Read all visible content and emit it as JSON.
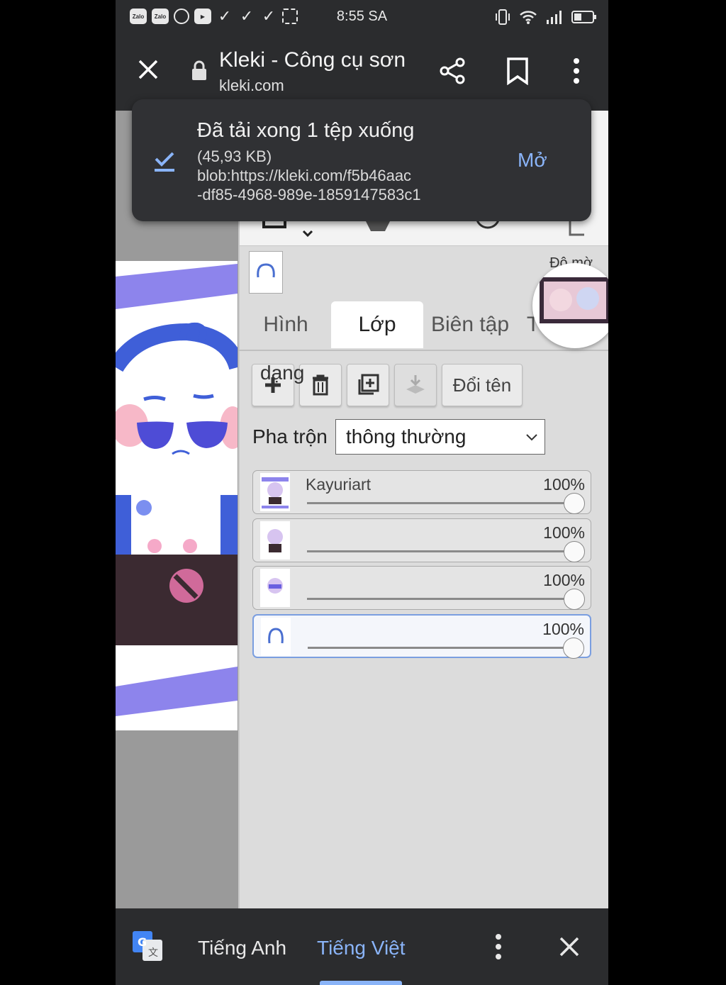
{
  "status_bar": {
    "time": "8:55 SA",
    "app_icons": [
      "Zalo",
      "Zalo"
    ]
  },
  "browser": {
    "title": "Kleki - Công cụ sơn",
    "url": "kleki.com"
  },
  "download": {
    "title": "Đã tải xong 1 tệp xuống",
    "size": "(45,93 KB)",
    "url_line1": "blob:https://kleki.com/f5b46aac",
    "url_line2": "-df85-4968-989e-1859147583c1",
    "open_label": "Mở"
  },
  "panel": {
    "opacity_label": "Độ mờ",
    "tabs": [
      {
        "label": "Hình"
      },
      {
        "label": "Lớp"
      },
      {
        "label": "Biên tập"
      },
      {
        "label": "T"
      }
    ],
    "overlay_label": "dạng",
    "rename_label": "Đổi tên",
    "blend_label": "Pha trộn",
    "blend_value": "thông thường",
    "layers": [
      {
        "name": "Kayuriart",
        "opacity": "100%"
      },
      {
        "name": "",
        "opacity": "100%"
      },
      {
        "name": "",
        "opacity": "100%"
      },
      {
        "name": "",
        "opacity": "100%"
      }
    ]
  },
  "translate": {
    "lang_from": "Tiếng Anh",
    "lang_to": "Tiếng Việt"
  },
  "colors": {
    "bar_dark": "#2b2c2e",
    "accent_blue": "#8ab4f8",
    "drawing_purple": "#7b72ea"
  }
}
